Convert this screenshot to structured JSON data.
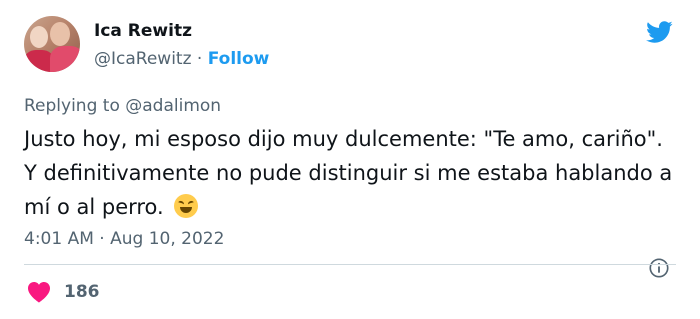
{
  "author": {
    "name": "Ica Rewitz",
    "handle": "@IcaRewitz",
    "separator": "·",
    "follow_label": "Follow"
  },
  "reply": {
    "prefix": "Replying to",
    "mention": "@adalimon"
  },
  "tweet": {
    "text": "Justo hoy, mi esposo dijo muy dulcemente: \"Te amo, cariño\". Y definitivamente no pude distinguir si me estaba hablando a mí o al perro.",
    "emoji": "rolling-on-floor-laughing"
  },
  "meta": {
    "time": "4:01 AM",
    "separator": "·",
    "date": "Aug 10, 2022"
  },
  "engagement": {
    "likes": "186"
  },
  "icons": {
    "brand": "twitter-bird-icon",
    "info": "info-icon",
    "like": "heart-icon"
  },
  "colors": {
    "brand": "#1d9bf0",
    "secondary_text": "#536471",
    "heart": "#f91880"
  }
}
